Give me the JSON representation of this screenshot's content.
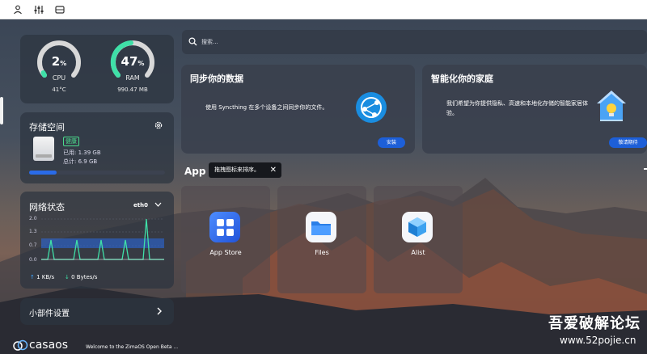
{
  "topbar": {
    "icons": [
      "user-icon",
      "sliders-icon",
      "drive-icon"
    ]
  },
  "system": {
    "cpu": {
      "value": "2",
      "unit": "%",
      "label": "CPU",
      "temp": "41°C",
      "percent": 2
    },
    "ram": {
      "value": "47",
      "unit": "%",
      "label": "RAM",
      "used": "990.47 MB",
      "percent": 47
    }
  },
  "storage": {
    "title": "存储空间",
    "status": "健康",
    "used": "已用: 1.39 GB",
    "total": "总计: 6.9 GB",
    "percent": 20
  },
  "network": {
    "title": "网络状态",
    "interface": "eth0",
    "y_ticks": [
      "2.0",
      "1.3",
      "0.7",
      "0.0"
    ],
    "up": "1 KB/s",
    "down": "0 Bytes/s"
  },
  "widget_settings": {
    "label": "小部件设置"
  },
  "brand": {
    "logo": "casaos",
    "welcome": "Welcome to the ZimaOS Open Beta ..."
  },
  "search": {
    "placeholder": "搜索..."
  },
  "sync_card": {
    "title": "同步你的数据",
    "body": "使用 Syncthing 在多个设备之间同步你的文件。",
    "button": "安装"
  },
  "home_card": {
    "title": "智能化你的家庭",
    "body": "我们希望为你提供隐私、高速和本地化存储的智能家居体验。",
    "button": "敬请期待"
  },
  "apps": {
    "title": "App",
    "tooltip": "拖拽图标来排序。",
    "items": [
      {
        "name": "App Store",
        "icon": "grid-icon"
      },
      {
        "name": "Files",
        "icon": "folder-icon"
      },
      {
        "name": "Alist",
        "icon": "cube-icon"
      }
    ]
  },
  "watermark": {
    "line1": "吾爱破解论坛",
    "line2": "www.52pojie.cn"
  },
  "colors": {
    "accent": "#1d5fd8",
    "gauge_green": "#3fe0a8",
    "bar_blue": "#2a6be8"
  }
}
